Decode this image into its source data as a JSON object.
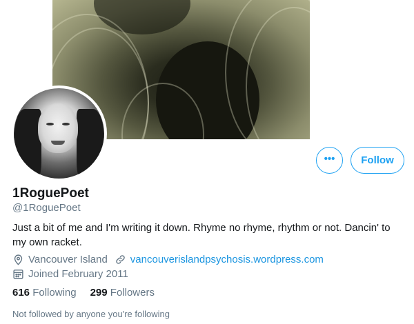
{
  "profile": {
    "display_name": "1RoguePoet",
    "handle": "@1RoguePoet",
    "bio": "Just a bit of me and I'm writing it down. Rhyme no rhyme, rhythm or not. Dancin' to my own racket.",
    "location": "Vancouver Island",
    "website": "vancouverislandpsychosis.wordpress.com",
    "joined": "Joined February 2011"
  },
  "actions": {
    "more_label": "•••",
    "follow_label": "Follow"
  },
  "stats": {
    "following_count": "616",
    "following_label": "Following",
    "followers_count": "299",
    "followers_label": "Followers"
  },
  "followed_by_note": "Not followed by anyone you're following",
  "icons": {
    "location": "location-pin-icon",
    "website": "link-icon",
    "joined": "calendar-icon",
    "more": "more-dots-icon"
  },
  "colors": {
    "accent": "#1da1f2",
    "link": "#1b95e0",
    "secondary_text": "#657786",
    "primary_text": "#14171a"
  }
}
